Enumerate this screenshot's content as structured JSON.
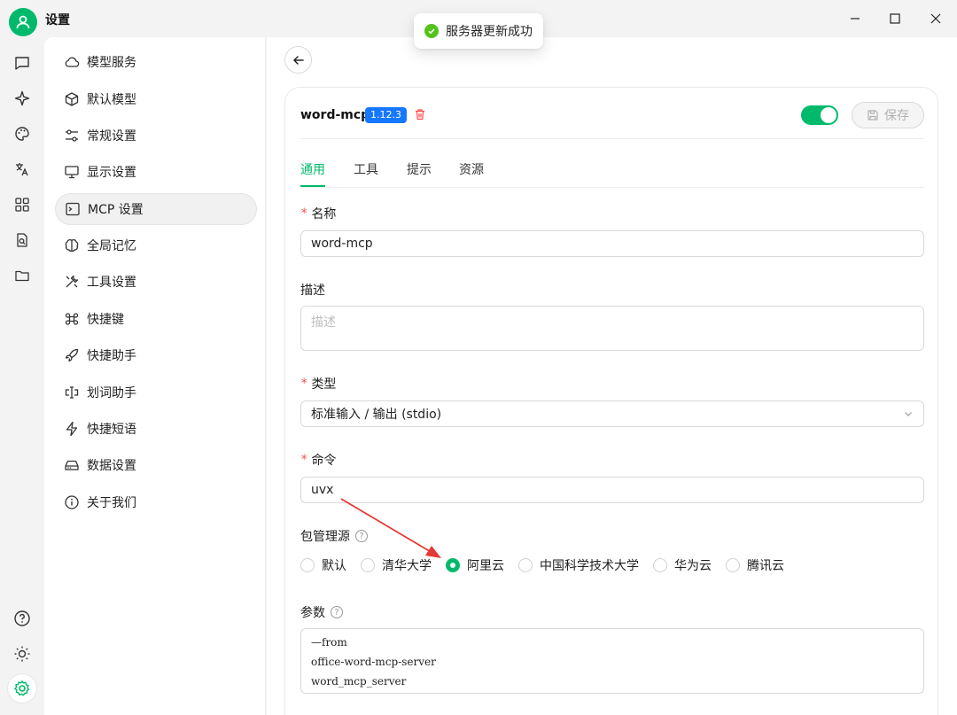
{
  "app": {
    "title": "设置"
  },
  "toast": {
    "message": "服务器更新成功"
  },
  "nav": {
    "items": [
      {
        "label": "模型服务",
        "icon": "cloud-icon"
      },
      {
        "label": "默认模型",
        "icon": "cube-icon"
      },
      {
        "label": "常规设置",
        "icon": "sliders-icon"
      },
      {
        "label": "显示设置",
        "icon": "monitor-icon"
      },
      {
        "label": "MCP 设置",
        "icon": "terminal-icon",
        "active": true
      },
      {
        "label": "全局记忆",
        "icon": "brain-icon"
      },
      {
        "label": "工具设置",
        "icon": "tools-icon"
      },
      {
        "label": "快捷键",
        "icon": "command-icon"
      },
      {
        "label": "快捷助手",
        "icon": "rocket-icon"
      },
      {
        "label": "划词助手",
        "icon": "text-cursor-icon"
      },
      {
        "label": "快捷短语",
        "icon": "zap-icon"
      },
      {
        "label": "数据设置",
        "icon": "hard-drive-icon"
      },
      {
        "label": "关于我们",
        "icon": "info-icon"
      }
    ]
  },
  "server": {
    "name": "word-mcp",
    "version": "1.12.3",
    "enabled": true,
    "save_label": "保存"
  },
  "tabs": [
    "通用",
    "工具",
    "提示",
    "资源"
  ],
  "form": {
    "name_label": "名称",
    "name_value": "word-mcp",
    "desc_label": "描述",
    "desc_placeholder": "描述",
    "type_label": "类型",
    "type_value": "标准输入 / 输出 (stdio)",
    "command_label": "命令",
    "command_value": "uvx",
    "registry_label": "包管理源",
    "registry_options": [
      "默认",
      "清华大学",
      "阿里云",
      "中国科学技术大学",
      "华为云",
      "腾讯云"
    ],
    "registry_selected": "阿里云",
    "args_label": "参数",
    "args_lines": [
      "—from",
      "office-word-mcp-server",
      "word_mcp_server"
    ]
  },
  "colors": {
    "accent": "#00b96b",
    "badge": "#1677ff",
    "danger": "#ff4d4f",
    "annotation": "#e53935"
  }
}
